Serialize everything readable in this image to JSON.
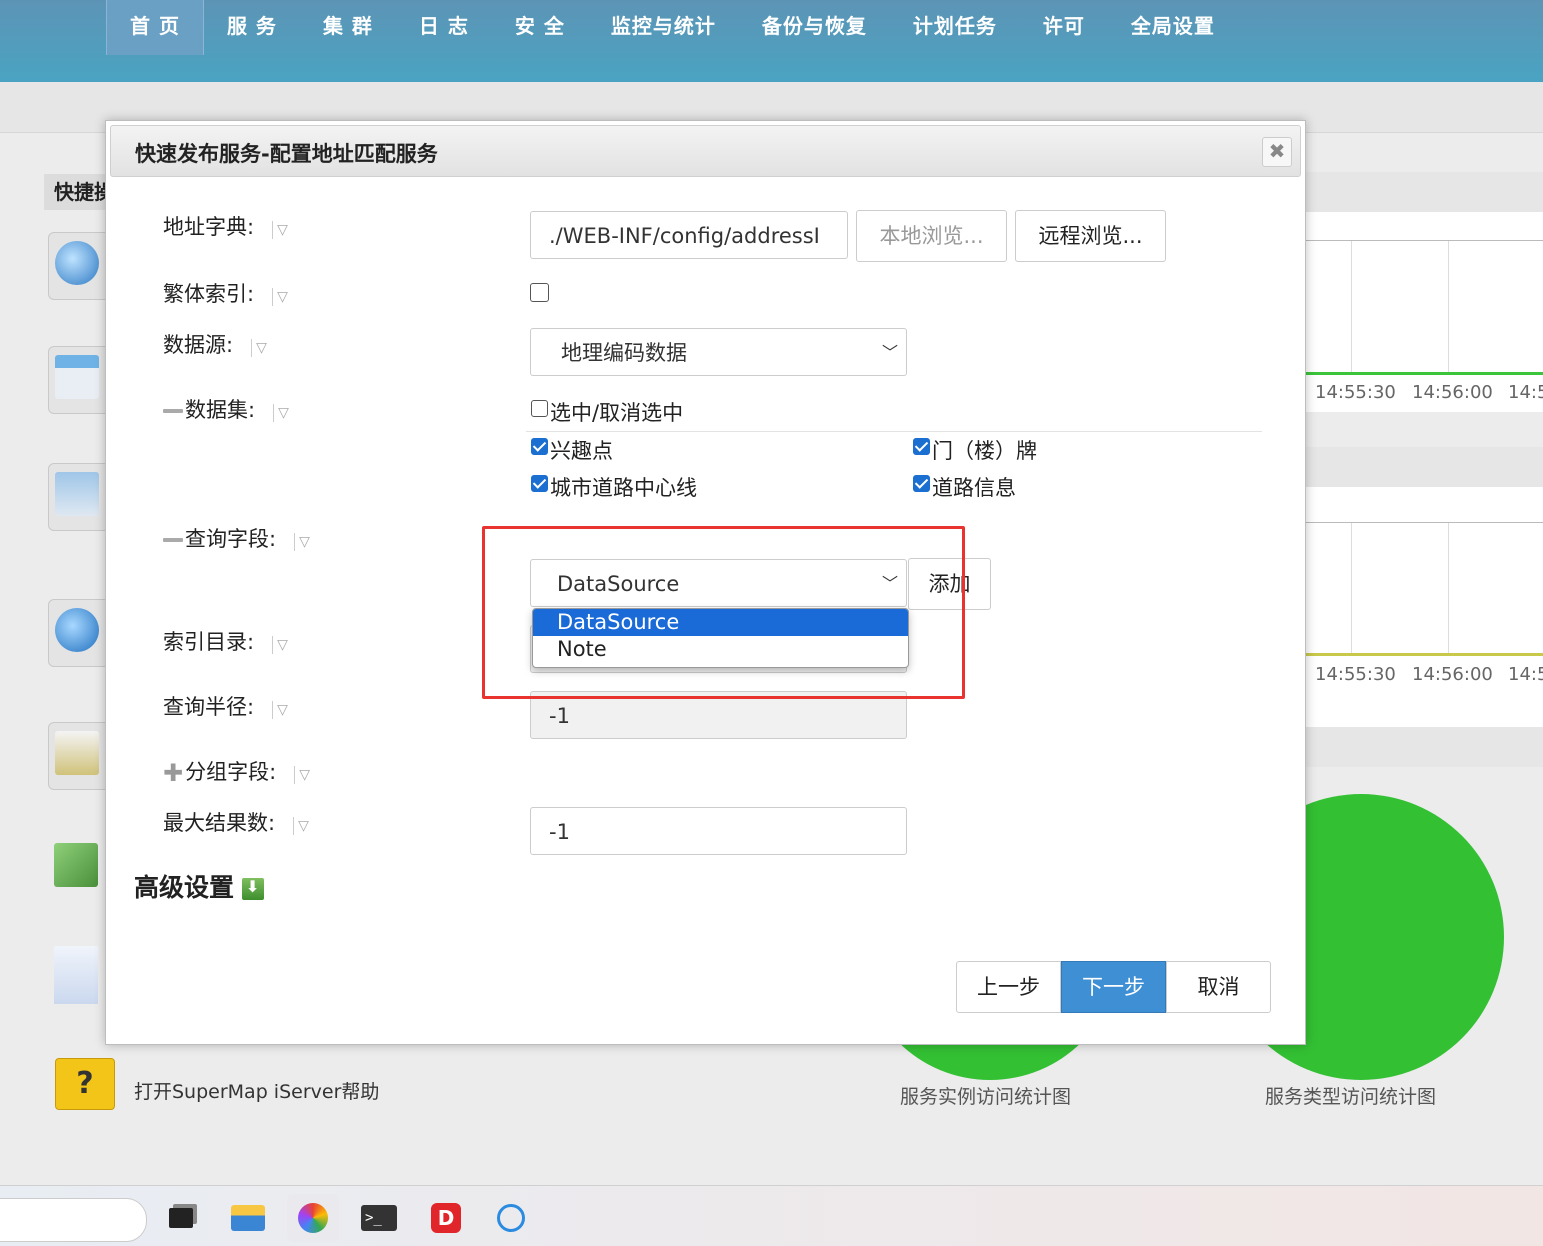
{
  "nav": {
    "items": [
      "首 页",
      "服 务",
      "集 群",
      "日 志",
      "安 全",
      "监控与统计",
      "备份与恢复",
      "计划任务",
      "许可",
      "全局设置"
    ],
    "active_index": 0
  },
  "background": {
    "quick_title": "快捷操作",
    "help_text": "打开SuperMap iServer帮助",
    "chart1_ticks": [
      "14:55:30",
      "14:56:00",
      "14:5"
    ],
    "chart2_ticks": [
      "14:55:30",
      "14:56:00",
      "14:5"
    ],
    "pie1_label": "服务实例访问统计图",
    "pie2_label": "服务类型访问统计图",
    "colors": {
      "pie": "#33c033",
      "line1": "#3cc43c",
      "line2": "#c8c84a"
    }
  },
  "modal": {
    "title": "快速发布服务-配置地址匹配服务",
    "close_icon": "close-icon",
    "labels": {
      "address_dict": "地址字典:",
      "traditional_index": "繁体索引:",
      "datasource": "数据源:",
      "dataset": "数据集:",
      "query_fields": "查询字段:",
      "index_dir": "索引目录:",
      "query_radius": "查询半径:",
      "group_fields": "分组字段:",
      "max_results": "最大结果数:"
    },
    "address_dict_value": "./WEB-INF/config/addressI",
    "local_browse": "本地浏览...",
    "remote_browse": "远程浏览...",
    "traditional_index_checked": false,
    "datasource_value": "地理编码数据",
    "select_all": {
      "label": "选中/取消选中",
      "checked": false
    },
    "datasets": [
      {
        "label": "兴趣点",
        "checked": true
      },
      {
        "label": "门（楼）牌",
        "checked": true
      },
      {
        "label": "城市道路中心线",
        "checked": true
      },
      {
        "label": "道路信息",
        "checked": true
      }
    ],
    "query_field_value": "DataSource",
    "add_button": "添加",
    "dropdown_options": [
      "DataSource",
      "Note"
    ],
    "dropdown_selected": "DataSource",
    "query_radius_value": "-1",
    "max_results_value": "-1",
    "advanced": "高级设置",
    "prev": "上一步",
    "next": "下一步",
    "cancel": "取消"
  }
}
